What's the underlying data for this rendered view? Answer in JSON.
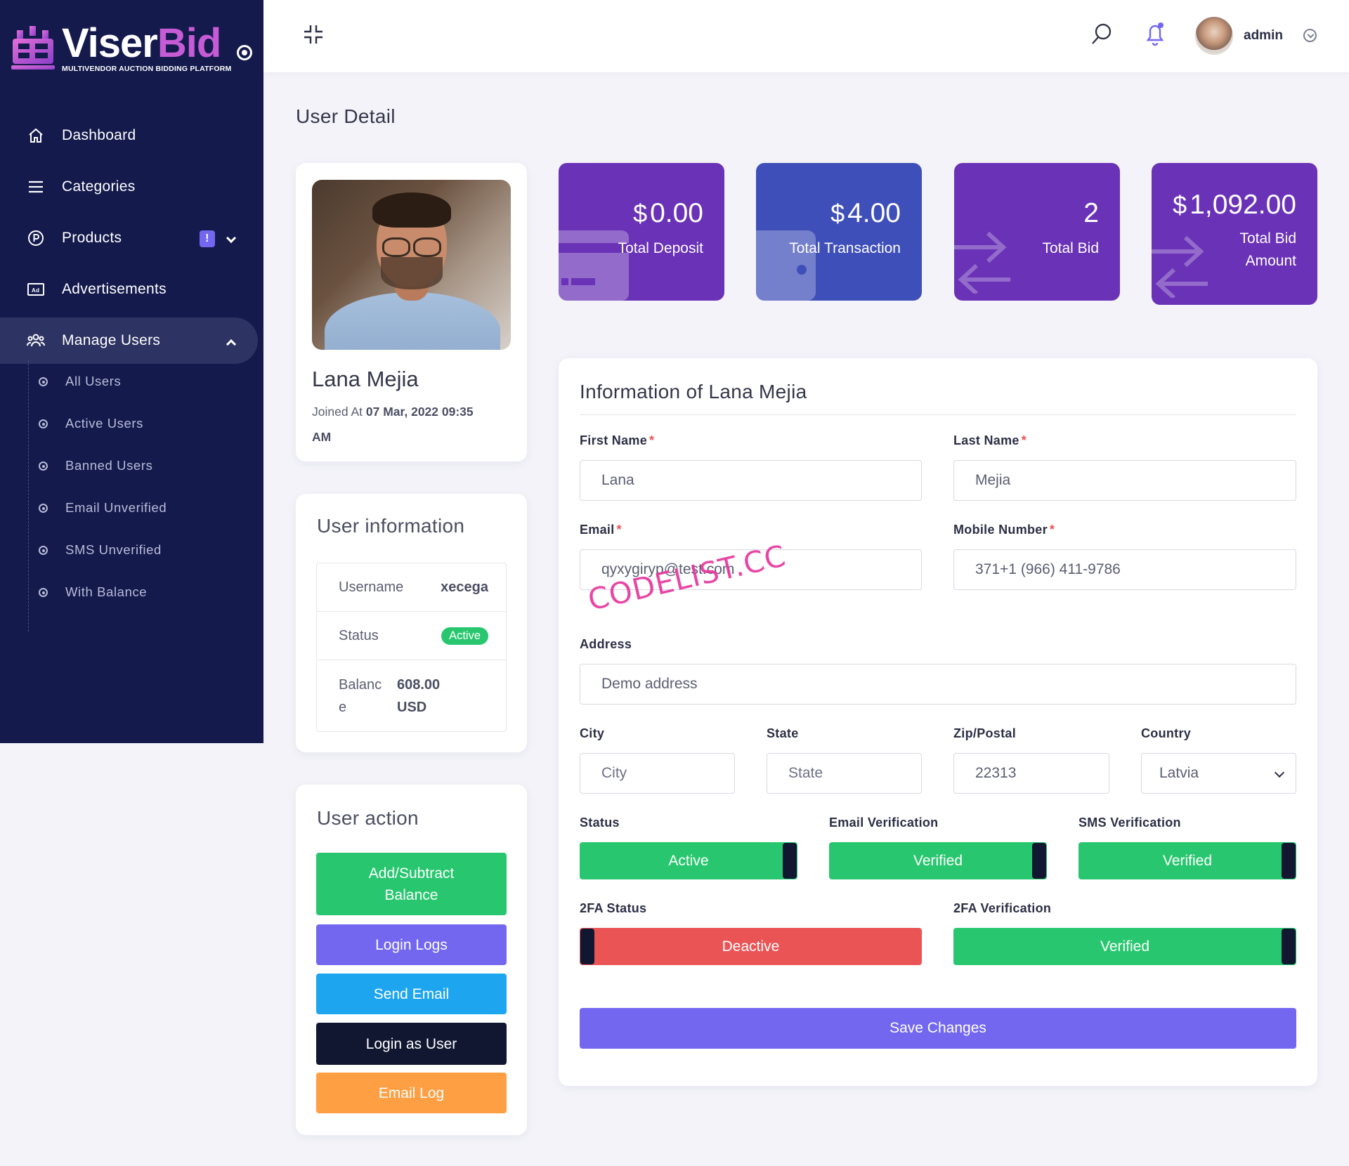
{
  "brand": {
    "name_part1": "Viser",
    "name_part2": "Bid",
    "tagline": "MULTIVENDOR AUCTION BIDDING PLATFORM"
  },
  "sidebar": {
    "items": [
      {
        "label": "Dashboard",
        "icon": "home-icon"
      },
      {
        "label": "Categories",
        "icon": "menu-icon"
      },
      {
        "label": "Products",
        "icon": "product-icon",
        "badge": "!"
      },
      {
        "label": "Advertisements",
        "icon": "ad-icon"
      },
      {
        "label": "Manage Users",
        "icon": "users-icon"
      }
    ],
    "submenu": [
      "All Users",
      "Active Users",
      "Banned Users",
      "Email Unverified",
      "SMS Unverified",
      "With Balance"
    ]
  },
  "topbar": {
    "username": "admin"
  },
  "page": {
    "title": "User Detail"
  },
  "profile": {
    "name": "Lana Mejia",
    "joined_label": "Joined At",
    "joined_value_line1": "07 Mar, 2022 09:35",
    "joined_value_line2": "AM"
  },
  "user_information": {
    "title": "User information",
    "username_label": "Username",
    "username_value": "xecega",
    "status_label": "Status",
    "status_value": "Active",
    "balance_label_1": "Balanc",
    "balance_label_2": "e",
    "balance_value_1": "608.00",
    "balance_value_2": "USD"
  },
  "user_action": {
    "title": "User action",
    "buttons": [
      {
        "label_1": "Add/Subtract",
        "label_2": "Balance",
        "color": "#28c76f"
      },
      {
        "label": "Login Logs",
        "color": "#7367f0"
      },
      {
        "label": "Send Email",
        "color": "#1ea5f0"
      },
      {
        "label": "Login as User",
        "color": "#111731"
      },
      {
        "label": "Email Log",
        "color": "#ff9f43"
      }
    ]
  },
  "stats": [
    {
      "currency": "$",
      "amount": "0.00",
      "label": "Total Deposit",
      "color": "#6a32b7"
    },
    {
      "currency": "$",
      "amount": "4.00",
      "label": "Total Transaction",
      "color": "#3f4fb9"
    },
    {
      "currency": "",
      "amount": "2",
      "label": "Total Bid",
      "color": "#6a32b7"
    },
    {
      "currency": "$",
      "amount": "1,092.00",
      "label_1": "Total Bid",
      "label_2": "Amount",
      "color": "#6a32b7"
    }
  ],
  "form": {
    "title": "Information of Lana Mejia",
    "first_name": {
      "label": "First Name",
      "req": "*",
      "value": "Lana"
    },
    "last_name": {
      "label": "Last Name",
      "req": "*",
      "value": "Mejia"
    },
    "email": {
      "label": "Email",
      "req": "*",
      "value": "qyxygiryp@test.com"
    },
    "mobile": {
      "label": "Mobile Number",
      "req": "*",
      "value": "371+1 (966) 411-9786"
    },
    "address": {
      "label": "Address",
      "value": "Demo address"
    },
    "city": {
      "label": "City",
      "placeholder": "City"
    },
    "state": {
      "label": "State",
      "placeholder": "State"
    },
    "zip": {
      "label": "Zip/Postal",
      "value": "22313"
    },
    "country": {
      "label": "Country",
      "value": "Latvia"
    },
    "status": {
      "label": "Status",
      "value": "Active",
      "on": true
    },
    "email_verification": {
      "label": "Email Verification",
      "value": "Verified",
      "on": true
    },
    "sms_verification": {
      "label": "SMS Verification",
      "value": "Verified",
      "on": true
    },
    "twofa_status": {
      "label": "2FA Status",
      "value": "Deactive",
      "on": false
    },
    "twofa_verification": {
      "label": "2FA Verification",
      "value": "Verified",
      "on": true
    },
    "save_label": "Save Changes"
  },
  "watermark": "CODELIST.CC"
}
